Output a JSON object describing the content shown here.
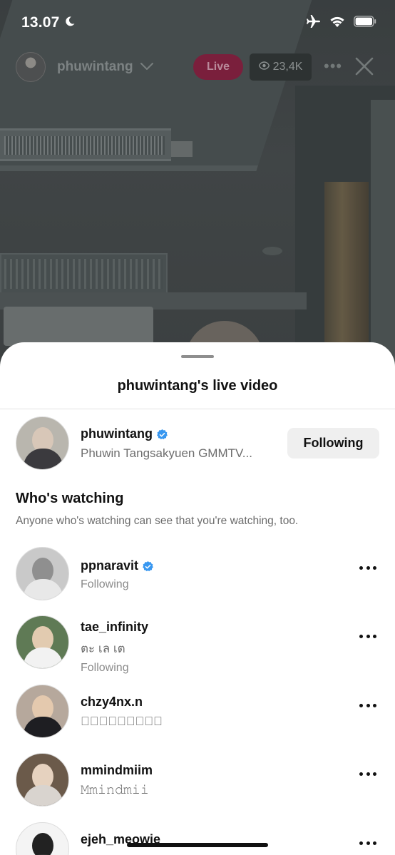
{
  "status_bar": {
    "time": "13.07"
  },
  "live_header": {
    "host_username": "phuwintang",
    "live_label": "Live",
    "viewer_count": "23,4K"
  },
  "sheet": {
    "title": "phuwintang's live video",
    "host": {
      "username": "phuwintang",
      "verified": true,
      "subtitle": "Phuwin Tangsakyuen GMMTV...",
      "button_label": "Following"
    },
    "section_title": "Who's watching",
    "section_subtitle": "Anyone who's watching can see that you're watching, too.",
    "viewers": [
      {
        "username": "ppnaravit",
        "verified": true,
        "name": "",
        "status": "Following"
      },
      {
        "username": "tae_infinity",
        "verified": false,
        "name": "ตะ เล เต",
        "status": "Following"
      },
      {
        "username": "chzy4nx.n",
        "verified": false,
        "name": "𝐜𝐡𝐚𝐲𝐚𝐧𝐚𝐧ཻ",
        "status": ""
      },
      {
        "username": "mmindmiim",
        "verified": false,
        "name": "𝙼𝚖𝚒𝚗𝚍𝚖𝚒𝚒",
        "status": ""
      },
      {
        "username": "ejeh_meowie",
        "verified": false,
        "name": "",
        "status": ""
      }
    ]
  },
  "colors": {
    "accent_live": "#7a1f3c",
    "verified_blue": "#3897f0",
    "button_bg": "#efefef"
  },
  "icons": [
    "moon-icon",
    "airplane-icon",
    "wifi-icon",
    "battery-icon",
    "chevron-down-icon",
    "eye-icon",
    "more-icon",
    "close-icon",
    "verified-badge-icon"
  ]
}
